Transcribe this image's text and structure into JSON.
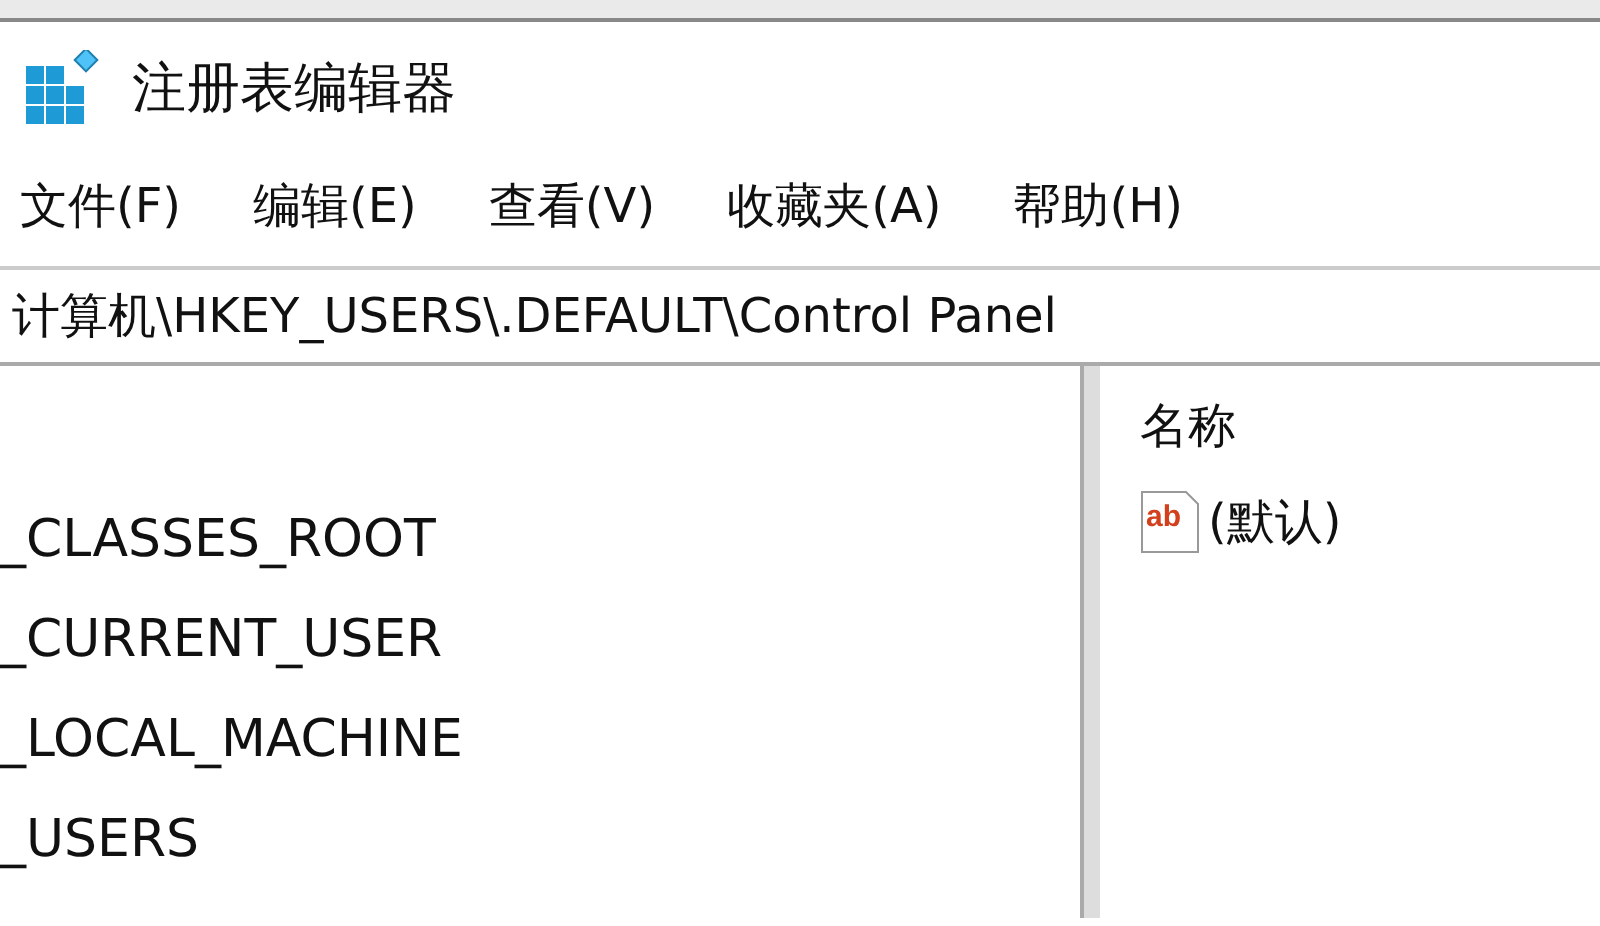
{
  "window": {
    "title": "注册表编辑器"
  },
  "menu": [
    "文件(F)",
    "编辑(E)",
    "查看(V)",
    "收藏夹(A)",
    "帮助(H)"
  ],
  "address": "计算机\\HKEY_USERS\\.DEFAULT\\Control Panel",
  "tree": {
    "items": [
      {
        "label": "_CLASSES_ROOT"
      },
      {
        "label": "_CURRENT_USER"
      },
      {
        "label": "_LOCAL_MACHINE"
      },
      {
        "label": "_USERS"
      }
    ]
  },
  "list": {
    "column": "名称",
    "rows": [
      {
        "name": "(默认)",
        "kind": "string",
        "icon_label": "ab"
      }
    ]
  }
}
